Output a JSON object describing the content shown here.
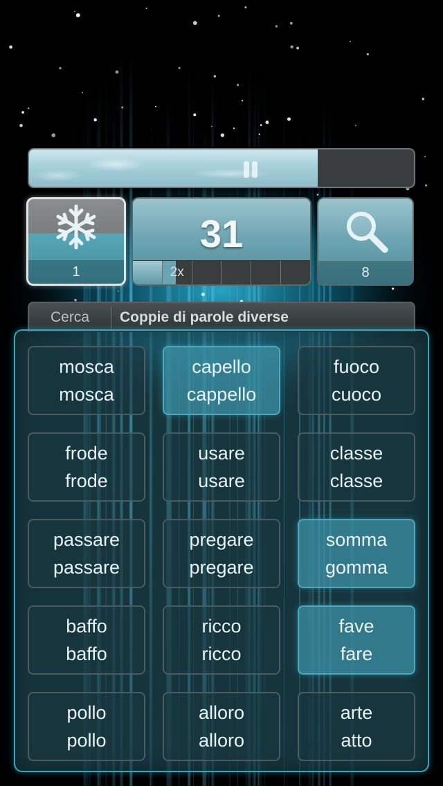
{
  "timer": {
    "remaining_fraction": 0.75
  },
  "powerups": {
    "freeze": {
      "count": "1",
      "icon": "snowflake-icon"
    },
    "magnify": {
      "count": "8",
      "icon": "magnifier-icon"
    }
  },
  "score": {
    "value": "31",
    "multiplier_label": "2x",
    "multiplier_segments_filled": 1.5,
    "multiplier_segments_total": 6
  },
  "category": {
    "search_label": "Cerca",
    "title": "Coppie di parole diverse"
  },
  "cards": [
    {
      "top": "mosca",
      "bottom": "mosca",
      "highlighted": false
    },
    {
      "top": "capello",
      "bottom": "cappello",
      "highlighted": true
    },
    {
      "top": "fuoco",
      "bottom": "cuoco",
      "highlighted": false
    },
    {
      "top": "frode",
      "bottom": "frode",
      "highlighted": false
    },
    {
      "top": "usare",
      "bottom": "usare",
      "highlighted": false
    },
    {
      "top": "classe",
      "bottom": "classe",
      "highlighted": false
    },
    {
      "top": "passare",
      "bottom": "passare",
      "highlighted": false
    },
    {
      "top": "pregare",
      "bottom": "pregare",
      "highlighted": false
    },
    {
      "top": "somma",
      "bottom": "gomma",
      "highlighted": true
    },
    {
      "top": "baffo",
      "bottom": "baffo",
      "highlighted": false
    },
    {
      "top": "ricco",
      "bottom": "ricco",
      "highlighted": false
    },
    {
      "top": "fave",
      "bottom": "fare",
      "highlighted": true
    },
    {
      "top": "pollo",
      "bottom": "pollo",
      "highlighted": false
    },
    {
      "top": "alloro",
      "bottom": "alloro",
      "highlighted": false
    },
    {
      "top": "arte",
      "bottom": "atto",
      "highlighted": false
    }
  ],
  "colors": {
    "accent": "#3aa6bd",
    "board_bg": "#285f6e",
    "card_highlight": "#3c91a5"
  }
}
